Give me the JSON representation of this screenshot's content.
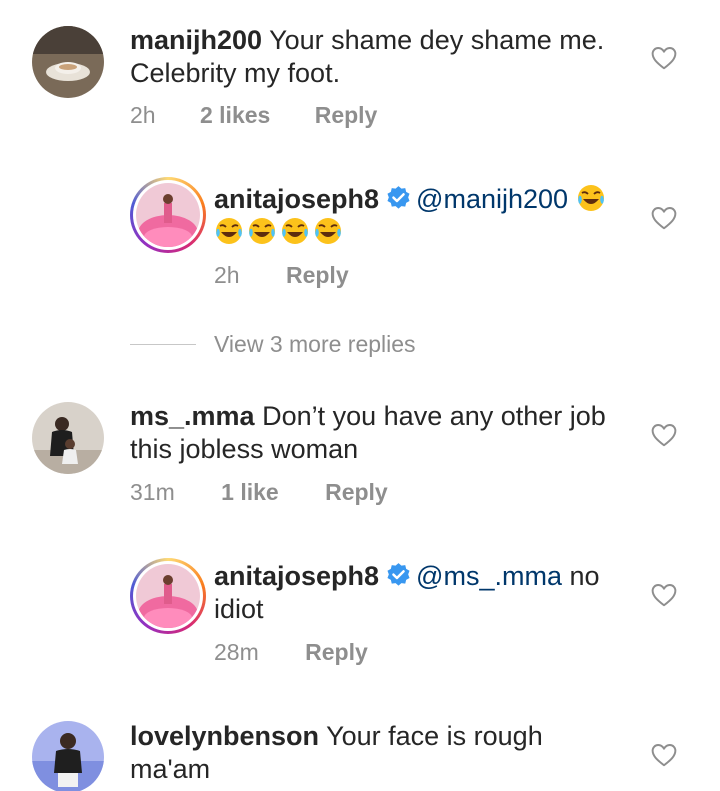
{
  "comments": [
    {
      "username": "manijh200",
      "text": "Your shame dey shame me. Celebrity my foot.",
      "line1": "Your shame dey shame me.",
      "line2": "Celebrity my foot.",
      "time": "2h",
      "likes": "2 likes",
      "reply": "Reply"
    },
    {
      "username": "anitajoseph8",
      "mention": "@manijh200",
      "time": "2h",
      "reply": "Reply",
      "verified": true,
      "emoji": "face-with-tears-of-joy"
    },
    {
      "username": "ms_.mma",
      "line1": "Don’t you have any other job",
      "line2": "this jobless woman",
      "time": "31m",
      "likes": "1 like",
      "reply": "Reply"
    },
    {
      "username": "anitajoseph8",
      "mention": "@ms_.mma",
      "text_after": "no",
      "line2": "idiot",
      "time": "28m",
      "reply": "Reply",
      "verified": true
    },
    {
      "username": "lovelynbenson",
      "line1": "Your face is rough",
      "line2": "ma'am"
    }
  ],
  "view_more": "View 3 more replies",
  "colors": {
    "text": "#262626",
    "muted": "#8e8e8e",
    "mention": "#00376b",
    "verified": "#3897f0"
  }
}
